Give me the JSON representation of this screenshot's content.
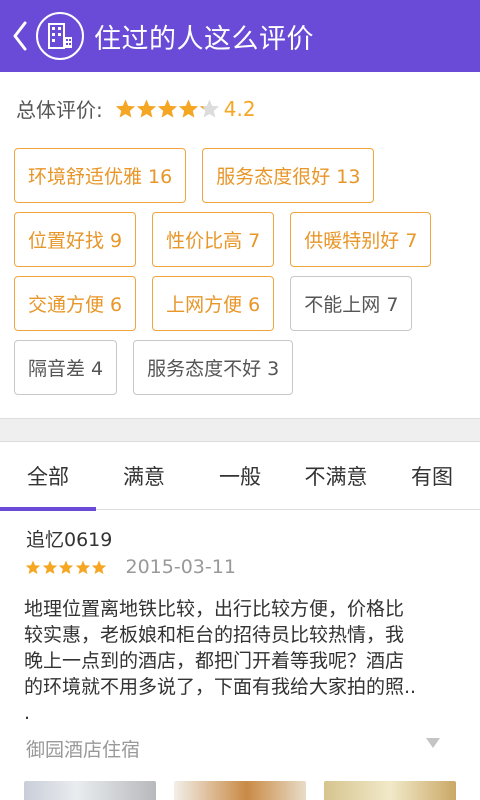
{
  "header": {
    "title": "住过的人这么评价",
    "background": "#6a4bd8",
    "back_icon": "chevron-left-icon",
    "logo_icon": "hotel-building-icon"
  },
  "summary": {
    "overall_label": "总体评价:",
    "rating": 4.2,
    "rating_text": "4.2",
    "star_color": "#f5a623"
  },
  "tags": [
    {
      "label": "环境舒适优雅 16",
      "sentiment": "positive"
    },
    {
      "label": "服务态度很好 13",
      "sentiment": "positive"
    },
    {
      "label": "位置好找 9",
      "sentiment": "positive"
    },
    {
      "label": "性价比高 7",
      "sentiment": "positive"
    },
    {
      "label": "供暖特别好 7",
      "sentiment": "positive"
    },
    {
      "label": "交通方便 6",
      "sentiment": "positive"
    },
    {
      "label": "上网方便 6",
      "sentiment": "positive"
    },
    {
      "label": "不能上网 7",
      "sentiment": "negative"
    },
    {
      "label": "隔音差 4",
      "sentiment": "negative"
    },
    {
      "label": "服务态度不好 3",
      "sentiment": "negative"
    }
  ],
  "tabs": [
    {
      "label": "全部",
      "active": true
    },
    {
      "label": "满意",
      "active": false
    },
    {
      "label": "一般",
      "active": false
    },
    {
      "label": "不满意",
      "active": false
    },
    {
      "label": "有图",
      "active": false
    }
  ],
  "review": {
    "user": "追忆0619",
    "stars": 5,
    "date": "2015-03-11",
    "text_lines": [
      "地理位置离地铁比较，出行比较方便，价格比",
      "较实惠，老板娘和柜台的招待员比较热情，我",
      "晚上一点到的酒店，都把门开着等我呢？酒店",
      "的环境就不用多说了，下面有我给大家拍的照..",
      "."
    ],
    "source": "御园酒店住宿",
    "expand_icon": "triangle-down-icon"
  }
}
